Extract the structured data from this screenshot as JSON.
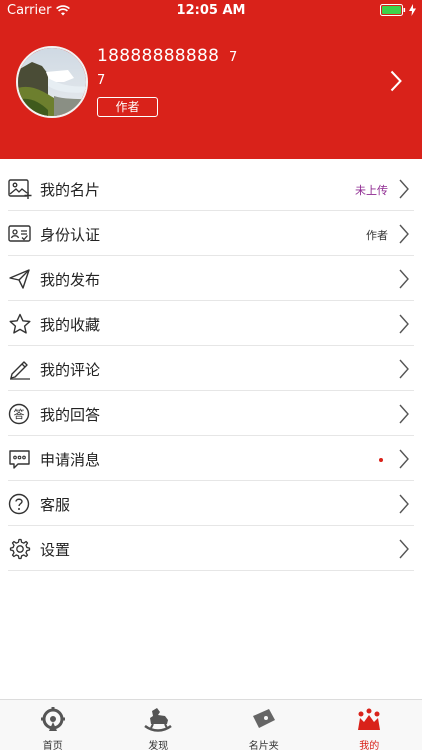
{
  "status_bar": {
    "carrier": "Carrier",
    "time": "12:05 AM"
  },
  "profile": {
    "phone": "18888888888",
    "phone_suffix": "7",
    "sub_number": "7",
    "role_badge": "作者"
  },
  "menu": [
    {
      "label": "我的名片",
      "value": "未上传",
      "icon": "card-image-icon"
    },
    {
      "label": "身份认证",
      "value": "作者",
      "icon": "id-card-icon"
    },
    {
      "label": "我的发布",
      "value": "",
      "icon": "send-icon"
    },
    {
      "label": "我的收藏",
      "value": "",
      "icon": "star-icon"
    },
    {
      "label": "我的评论",
      "value": "",
      "icon": "pencil-icon"
    },
    {
      "label": "我的回答",
      "value": "",
      "icon": "answer-icon"
    },
    {
      "label": "申请消息",
      "value": "",
      "icon": "message-icon"
    },
    {
      "label": "客服",
      "value": "",
      "icon": "help-icon"
    },
    {
      "label": "设置",
      "value": "",
      "icon": "gear-icon"
    }
  ],
  "tabs": [
    {
      "label": "首页",
      "icon": "home-icon"
    },
    {
      "label": "发现",
      "icon": "rocking-horse-icon"
    },
    {
      "label": "名片夹",
      "icon": "wallet-icon"
    },
    {
      "label": "我的",
      "icon": "crown-icon"
    }
  ],
  "colors": {
    "brand_red": "#d9221a",
    "purple_value": "#8e2a91"
  }
}
